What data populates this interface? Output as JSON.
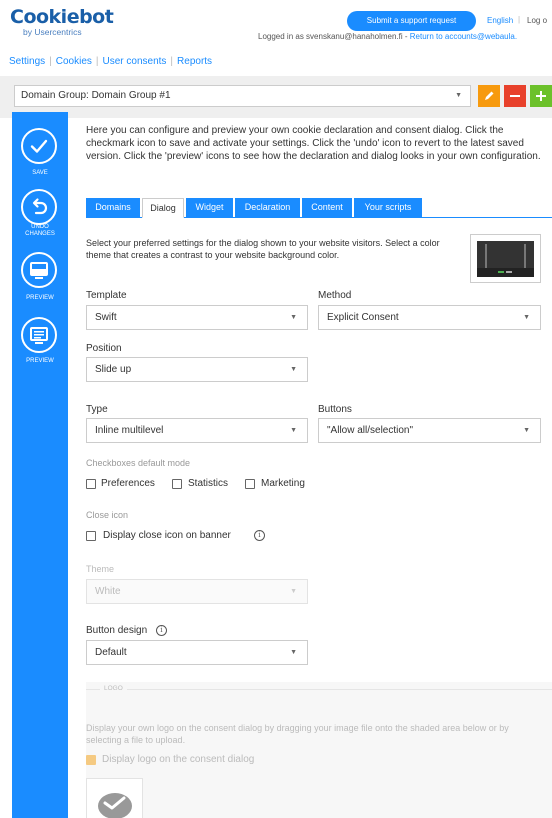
{
  "header": {
    "logo_text": "Cookiebot",
    "logo_sub": "by Usercentrics",
    "support_button": "Submit a support request",
    "language": "English",
    "logout": "Log o",
    "login_prefix": "Logged in as svenskanu@hanaholmen.fi - ",
    "login_link": "Return to accounts@webaula."
  },
  "nav": {
    "items": [
      "Settings",
      "Cookies",
      "User consents",
      "Reports"
    ]
  },
  "domain_group": {
    "selected": "Domain Group: Domain Group #1",
    "edit_icon": "pencil-icon",
    "remove_icon": "minus-icon",
    "add_icon": "plus-icon",
    "colors": {
      "edit": "#f79a0e",
      "remove": "#e8412b",
      "add": "#6cc12b"
    }
  },
  "sidebar": {
    "save_label": "SAVE",
    "undo_label_1": "UNDO",
    "undo_label_2": "CHANGES",
    "preview_dialog_label": "PREVIEW",
    "preview_declaration_label": "PREVIEW"
  },
  "intro": "Here you can configure and preview your own cookie declaration and consent dialog. Click the checkmark icon to save and activate your settings. Click the 'undo' icon to revert to the latest saved version. Click the 'preview' icons to see how the declaration and dialog looks in your own configuration.",
  "tabs": [
    "Domains",
    "Dialog",
    "Widget",
    "Declaration",
    "Content",
    "Your scripts"
  ],
  "active_tab": "Dialog",
  "dialog": {
    "description": "Select your preferred settings for the dialog shown to your website visitors. Select a color theme that creates a contrast to your website background color.",
    "template_label": "Template",
    "template_value": "Swift",
    "method_label": "Method",
    "method_value": "Explicit Consent",
    "position_label": "Position",
    "position_value": "Slide up",
    "type_label": "Type",
    "type_value": "Inline multilevel",
    "buttons_label": "Buttons",
    "buttons_value": "\"Allow all/selection\"",
    "checkboxes_label": "Checkboxes default mode",
    "checkbox_preferences": "Preferences",
    "checkbox_statistics": "Statistics",
    "checkbox_marketing": "Marketing",
    "close_icon_label": "Close icon",
    "close_icon_checkbox": "Display close icon on banner",
    "theme_label": "Theme",
    "theme_value": "White",
    "button_design_label": "Button design",
    "button_design_value": "Default"
  },
  "logo_section": {
    "legend": "LOGO",
    "description": "Display your own logo on the consent dialog by dragging your image file onto the shaded area below or by selecting a file to upload.",
    "display_checkbox": "Display logo on the consent dialog"
  }
}
